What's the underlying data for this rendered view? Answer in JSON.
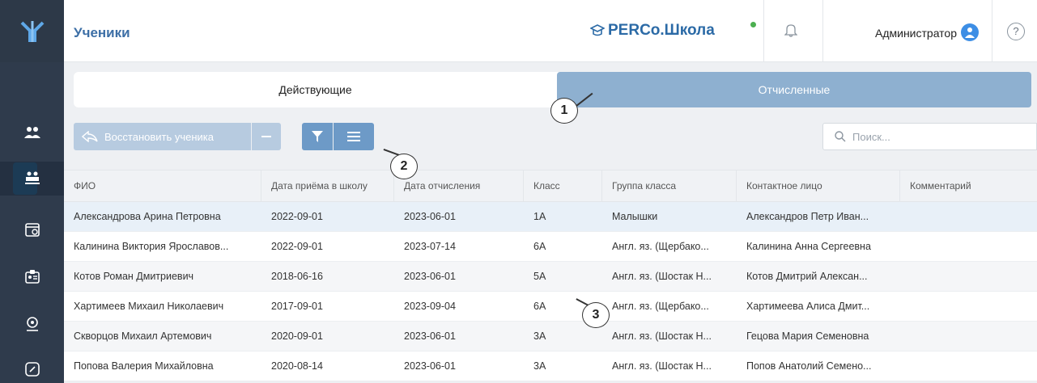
{
  "header": {
    "title": "Ученики",
    "brand": "PERCo.Школа",
    "user": "Администратор",
    "help": "?"
  },
  "tabs": [
    {
      "label": "Действующие"
    },
    {
      "label": "Отчисленные"
    }
  ],
  "toolbar": {
    "restore_label": "Восстановить ученика"
  },
  "search": {
    "placeholder": "Поиск..."
  },
  "table": {
    "columns": [
      "ФИО",
      "Дата приёма в школу",
      "Дата отчисления",
      "Класс",
      "Группа класса",
      "Контактное лицо",
      "Комментарий"
    ],
    "rows": [
      [
        "Александрова Арина Петровна",
        "2022-09-01",
        "2023-06-01",
        "1А",
        "Малышки",
        "Александров Петр Иван...",
        ""
      ],
      [
        "Калинина Виктория Ярославов...",
        "2022-09-01",
        "2023-07-14",
        "6А",
        "Англ. яз. (Щербако...",
        "Калинина Анна Сергеевна",
        ""
      ],
      [
        "Котов Роман Дмитриевич",
        "2018-06-16",
        "2023-06-01",
        "5А",
        "Англ. яз. (Шостак Н...",
        "Котов Дмитрий Алексан...",
        ""
      ],
      [
        "Хартимеев Михаил Николаевич",
        "2017-09-01",
        "2023-09-04",
        "6А",
        "Англ. яз. (Щербако...",
        "Хартимеева Алиса Дмит...",
        ""
      ],
      [
        "Скворцов Михаил Артемович",
        "2020-09-01",
        "2023-06-01",
        "3А",
        "Англ. яз. (Шостак Н...",
        "Гецова Мария Семеновна",
        ""
      ],
      [
        "Попова Валерия Михайловна",
        "2020-08-14",
        "2023-06-01",
        "3А",
        "Англ. яз. (Шостак Н...",
        "Попов Анатолий Семено...",
        ""
      ]
    ]
  },
  "callouts": [
    "1",
    "2",
    "3"
  ],
  "colors": {
    "sidebar": "#2f3b4c",
    "accent": "#3d6fa6",
    "tab_inactive": "#8eb0d0"
  }
}
